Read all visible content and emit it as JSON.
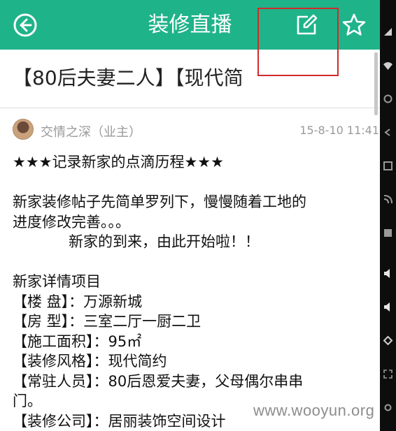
{
  "header": {
    "title": "装修直播",
    "colors": {
      "bar": "#1fb38a",
      "highlight_box": "#d12a2a"
    },
    "icons": [
      "back-icon",
      "edit-icon",
      "star-icon"
    ]
  },
  "post": {
    "title": "【80后夫妻二人】【现代简",
    "author": "交情之深（业主）",
    "time": "15-8-10 11:41",
    "lines": [
      "★★★记录新家的点滴历程★★★",
      "",
      "新家装修帖子先简单罗列下，慢慢随着工地的",
      "进度修改完善。。。",
      "新家的到来，由此开始啦！！",
      "",
      "新家详情项目",
      "【楼    盘】：万源新城",
      "【房    型】：三室二厅一厨二卫",
      "【施工面积】：95㎡",
      "【装修风格】：现代简约",
      "【常驻人员】：80后恩爱夫妻，父母偶尔串串",
      "门。",
      "【装修公司】：居丽装饰空间设计"
    ]
  },
  "watermark": "www.wooyun.org"
}
